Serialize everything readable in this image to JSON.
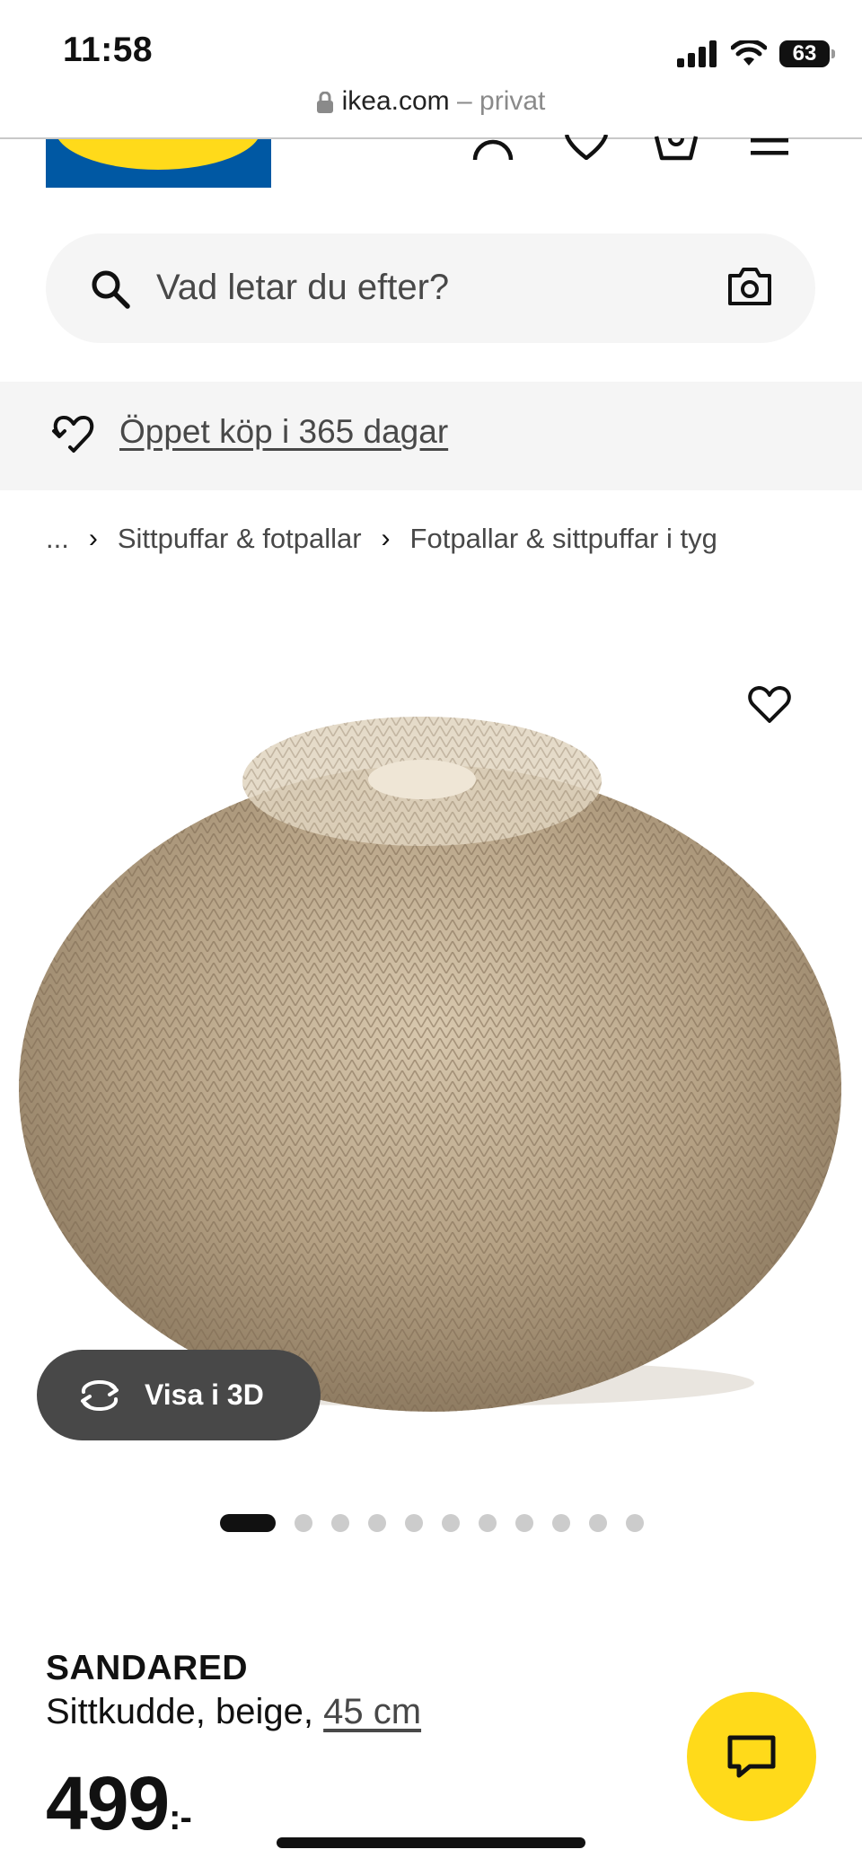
{
  "status_bar": {
    "time": "11:58",
    "battery": "63",
    "icons": [
      "cellular-signal-icon",
      "wifi-icon",
      "battery-icon"
    ]
  },
  "browser": {
    "domain": "ikea.com",
    "mode": "– privat"
  },
  "header": {
    "logo_text": "IKEA",
    "icons": [
      "user-icon",
      "heart-icon",
      "cart-icon",
      "hamburger-menu-icon"
    ]
  },
  "search": {
    "placeholder": "Vad letar du efter?"
  },
  "promo": {
    "text": "Öppet köp i 365 dagar"
  },
  "breadcrumb": {
    "ellipsis": "...",
    "items": [
      "Sittpuffar & fotpallar",
      "Fotpallar & sittpuffar i tyg"
    ]
  },
  "gallery": {
    "image_alt": "SANDARED sittkudde beige",
    "view3d_label": "Visa i 3D",
    "slide_count": 12,
    "active_slide": 1
  },
  "product": {
    "name": "SANDARED",
    "description": "Sittkudde, beige, ",
    "size": "45 cm",
    "price": "499",
    "price_suffix": ":-"
  },
  "colors": {
    "ikea_blue": "#0058a3",
    "ikea_yellow": "#ffda1a",
    "text_dark": "#111111",
    "text_grey": "#484848",
    "surface_grey": "#f5f5f5"
  }
}
